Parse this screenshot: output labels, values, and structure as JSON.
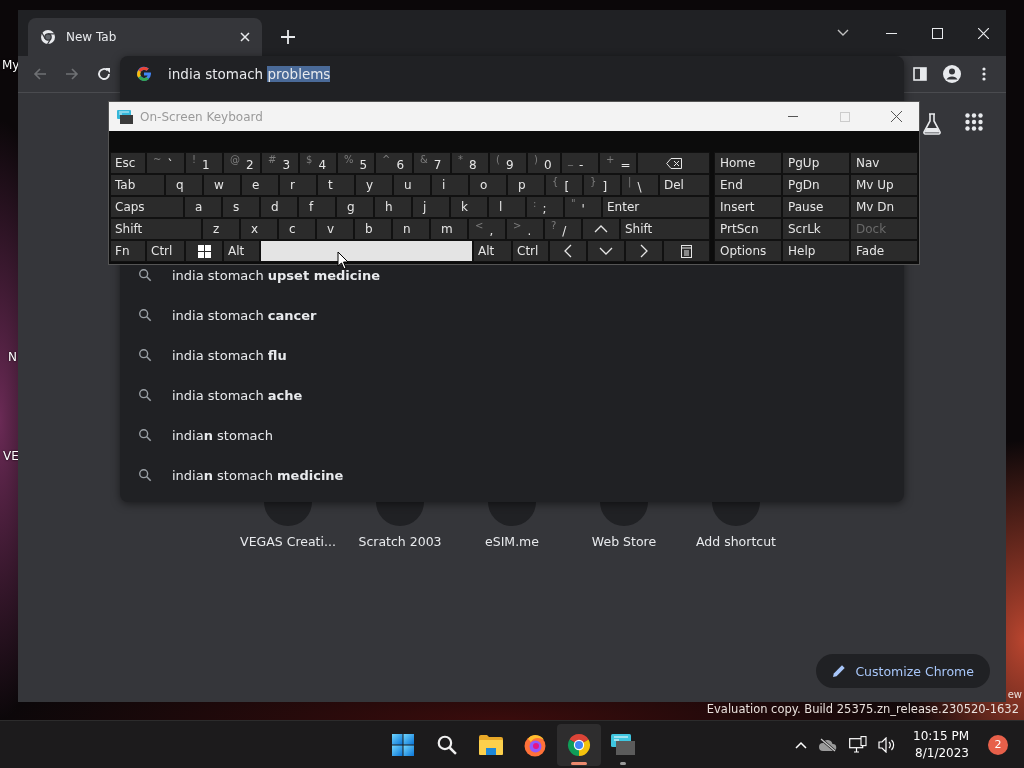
{
  "desktop": {
    "icon_labels": [
      "My",
      "N",
      "VE"
    ],
    "watermark_lines": [
      "ew",
      "Evaluation copy. Build 25375.zn_release.230520-1632"
    ]
  },
  "browser": {
    "tabs": [
      {
        "title": "New Tab",
        "selected": true
      }
    ],
    "back_enabled": false,
    "forward_enabled": false,
    "omnibox": {
      "text": "india stomach ",
      "selected_text": "problems"
    },
    "suggestions": [
      "india stomach **upset medicine**",
      "india stomach **cancer**",
      "india stomach **flu**",
      "india stomach **ache**",
      "india**n** stomach",
      "india**n** stomach **medicine**"
    ],
    "shortcuts": [
      "VEGAS Creati...",
      "Scratch 2003",
      "eSIM.me",
      "Web Store",
      "Add shortcut"
    ],
    "customize_button": "Customize Chrome"
  },
  "osk": {
    "title": "On-Screen Keyboard",
    "title_active": false,
    "main_rows": [
      [
        {
          "kind": "key",
          "label": "Esc"
        },
        {
          "kind": "key",
          "shift": "~",
          "label": "`"
        },
        {
          "kind": "key",
          "shift": "!",
          "label": "1"
        },
        {
          "kind": "key",
          "shift": "@",
          "label": "2"
        },
        {
          "kind": "key",
          "shift": "#",
          "label": "3"
        },
        {
          "kind": "key",
          "shift": "$",
          "label": "4"
        },
        {
          "kind": "key",
          "shift": "%",
          "label": "5"
        },
        {
          "kind": "key",
          "shift": "^",
          "label": "6"
        },
        {
          "kind": "key",
          "shift": "&",
          "label": "7"
        },
        {
          "kind": "key",
          "shift": "*",
          "label": "8"
        },
        {
          "kind": "key",
          "shift": "(",
          "label": "9"
        },
        {
          "kind": "key",
          "shift": ")",
          "label": "0"
        },
        {
          "kind": "key",
          "shift": "_",
          "label": "-"
        },
        {
          "kind": "key",
          "shift": "+",
          "label": "="
        },
        {
          "kind": "backspace"
        }
      ],
      [
        {
          "kind": "key",
          "label": "Tab"
        },
        {
          "kind": "key",
          "label": "q"
        },
        {
          "kind": "key",
          "label": "w"
        },
        {
          "kind": "key",
          "label": "e"
        },
        {
          "kind": "key",
          "label": "r"
        },
        {
          "kind": "key",
          "label": "t"
        },
        {
          "kind": "key",
          "label": "y"
        },
        {
          "kind": "key",
          "label": "u"
        },
        {
          "kind": "key",
          "label": "i"
        },
        {
          "kind": "key",
          "label": "o"
        },
        {
          "kind": "key",
          "label": "p"
        },
        {
          "kind": "key",
          "shift": "{",
          "label": "["
        },
        {
          "kind": "key",
          "shift": "}",
          "label": "]"
        },
        {
          "kind": "key",
          "shift": "|",
          "label": "\\"
        },
        {
          "kind": "key",
          "label": "Del"
        }
      ],
      [
        {
          "kind": "key",
          "label": "Caps"
        },
        {
          "kind": "key",
          "label": "a"
        },
        {
          "kind": "key",
          "label": "s"
        },
        {
          "kind": "key",
          "label": "d"
        },
        {
          "kind": "key",
          "label": "f"
        },
        {
          "kind": "key",
          "label": "g"
        },
        {
          "kind": "key",
          "label": "h"
        },
        {
          "kind": "key",
          "label": "j"
        },
        {
          "kind": "key",
          "label": "k"
        },
        {
          "kind": "key",
          "label": "l"
        },
        {
          "kind": "key",
          "shift": ":",
          "label": ";"
        },
        {
          "kind": "key",
          "shift": "\"",
          "label": "'"
        },
        {
          "kind": "key",
          "label": "Enter"
        }
      ],
      [
        {
          "kind": "key",
          "label": "Shift"
        },
        {
          "kind": "key",
          "label": "z"
        },
        {
          "kind": "key",
          "label": "x"
        },
        {
          "kind": "key",
          "label": "c"
        },
        {
          "kind": "key",
          "label": "v"
        },
        {
          "kind": "key",
          "label": "b"
        },
        {
          "kind": "key",
          "label": "n"
        },
        {
          "kind": "key",
          "label": "m"
        },
        {
          "kind": "key",
          "shift": "<",
          "label": ","
        },
        {
          "kind": "key",
          "shift": ">",
          "label": "."
        },
        {
          "kind": "key",
          "shift": "?",
          "label": "/"
        },
        {
          "kind": "up"
        },
        {
          "kind": "key",
          "label": "Shift"
        }
      ],
      [
        {
          "kind": "key",
          "label": "Fn"
        },
        {
          "kind": "key",
          "label": "Ctrl"
        },
        {
          "kind": "windows"
        },
        {
          "kind": "key",
          "label": "Alt"
        },
        {
          "kind": "space",
          "hovered": true
        },
        {
          "kind": "key",
          "label": "Alt"
        },
        {
          "kind": "key",
          "label": "Ctrl"
        },
        {
          "kind": "left"
        },
        {
          "kind": "down"
        },
        {
          "kind": "right"
        },
        {
          "kind": "menu"
        }
      ]
    ],
    "nav_rows": [
      [
        {
          "label": "Home",
          "disabled": false
        },
        {
          "label": "PgUp",
          "disabled": false
        },
        {
          "label": "Nav",
          "disabled": false
        }
      ],
      [
        {
          "label": "End",
          "disabled": false
        },
        {
          "label": "PgDn",
          "disabled": false
        },
        {
          "label": "Mv Up",
          "disabled": false
        }
      ],
      [
        {
          "label": "Insert",
          "disabled": false
        },
        {
          "label": "Pause",
          "disabled": false
        },
        {
          "label": "Mv Dn",
          "disabled": false
        }
      ],
      [
        {
          "label": "PrtScn",
          "disabled": false
        },
        {
          "label": "ScrLk",
          "disabled": false
        },
        {
          "label": "Dock",
          "disabled": true
        }
      ],
      [
        {
          "label": "Options",
          "disabled": false
        },
        {
          "label": "Help",
          "disabled": false
        },
        {
          "label": "Fade",
          "disabled": false
        }
      ]
    ]
  },
  "taskbar": {
    "items": [
      {
        "kind": "start",
        "running": false,
        "active": false
      },
      {
        "kind": "search",
        "running": false,
        "active": false
      },
      {
        "kind": "explorer",
        "running": false,
        "active": false
      },
      {
        "kind": "firefox",
        "running": false,
        "active": false
      },
      {
        "kind": "chrome",
        "running": true,
        "active": true
      },
      {
        "kind": "keyboard",
        "running": true,
        "active": false
      }
    ],
    "clock_time": "10:15 PM",
    "clock_date": "8/1/2023",
    "notification_count": "2"
  }
}
